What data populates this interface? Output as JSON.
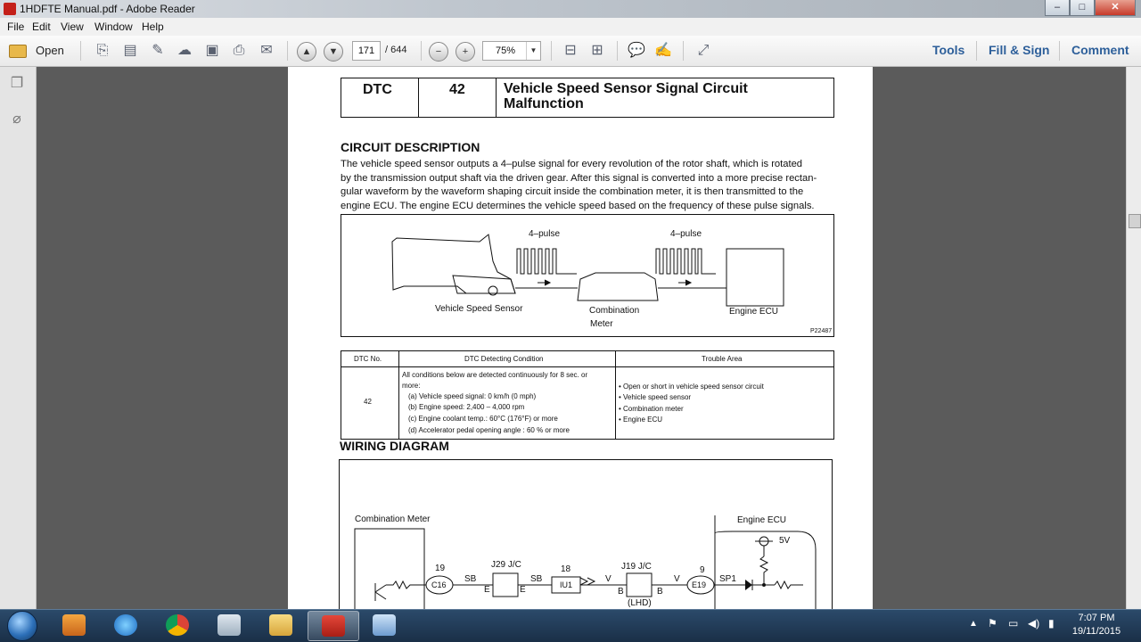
{
  "window": {
    "title": "1HDFTE Manual.pdf - Adobe Reader",
    "controls": {
      "minimize": "–",
      "maximize": "□",
      "close": "✕"
    }
  },
  "menu": [
    "File",
    "Edit",
    "View",
    "Window",
    "Help"
  ],
  "toolbar": {
    "open_label": "Open",
    "page_current": "171",
    "page_total": "/ 644",
    "zoom": "75%",
    "links": [
      "Tools",
      "Fill & Sign",
      "Comment"
    ]
  },
  "document": {
    "dtc_header": {
      "col1": "DTC",
      "col2": "42",
      "title_line1": "Vehicle Speed Sensor Signal Circuit",
      "title_line2": "Malfunction"
    },
    "circuit_description": {
      "heading": "CIRCUIT DESCRIPTION",
      "lines": [
        "The vehicle speed sensor outputs a 4–pulse signal for every revolution of the rotor shaft, which is rotated",
        "by the transmission output shaft via the driven gear. After this signal is converted into a more precise rectan-",
        "gular waveform by the waveform shaping circuit inside the combination meter, it is then transmitted to the",
        "engine ECU. The engine ECU determines the vehicle speed based on the frequency of these pulse signals."
      ]
    },
    "diagram": {
      "pulse_label_1": "4–pulse",
      "pulse_label_2": "4–pulse",
      "sensor_label": "Vehicle Speed Sensor",
      "meter_label_1": "Combination",
      "meter_label_2": "Meter",
      "ecu_label": "Engine ECU",
      "fig_id": "P22487"
    },
    "condition_table": {
      "headers": [
        "DTC No.",
        "DTC Detecting Condition",
        "Trouble Area"
      ],
      "dtc_no": "42",
      "condition_lines": [
        "All conditions below are detected continuously for 8 sec. or",
        "more:",
        "(a)    Vehicle speed signal:  0 km/h (0 mph)",
        "(b)    Engine speed:  2,400 – 4,000 rpm",
        "(c)    Engine coolant temp.:  60°C (176°F) or more",
        "(d)    Accelerator pedal opening angle : 60 % or more"
      ],
      "trouble_lines": [
        "• Open or short in vehicle speed sensor circuit",
        "• Vehicle speed sensor",
        "• Combination meter",
        "• Engine ECU"
      ]
    },
    "wiring": {
      "heading": "WIRING DIAGRAM",
      "combination_meter": "Combination Meter",
      "engine_ecu": "Engine ECU",
      "pin19": "19",
      "c16": "C16",
      "sb1": "SB",
      "e1": "E",
      "j29": "J29 J/C",
      "e2": "E",
      "sb2": "SB",
      "pin18": "18",
      "iu1": "IU1",
      "v1": "V",
      "j19": "J19 J/C",
      "v2": "V",
      "b1": "B",
      "b2": "B",
      "lhd": "(LHD)",
      "pin9": "9",
      "e19": "E19",
      "sp1": "SP1",
      "v5": "5V"
    }
  },
  "taskbar": {
    "time": "7:07 PM",
    "date": "19/11/2015"
  }
}
